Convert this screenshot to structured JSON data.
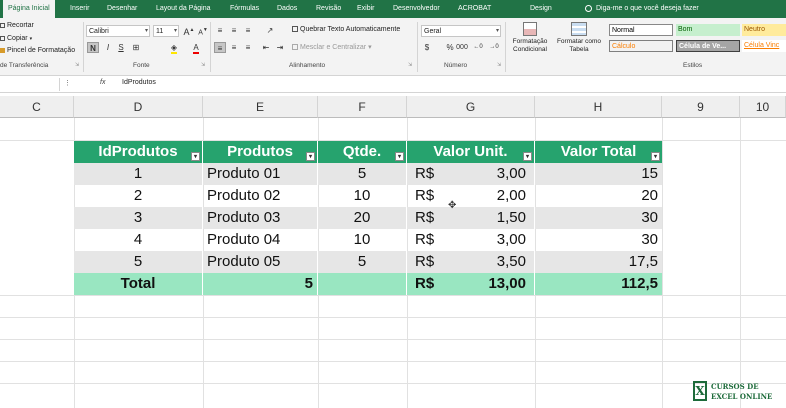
{
  "tabs": [
    "Página Inicial",
    "Inserir",
    "Desenhar",
    "Layout da Página",
    "Fórmulas",
    "Dados",
    "Revisão",
    "Exibir",
    "Desenvolvedor",
    "ACROBAT",
    "Design"
  ],
  "tell_me": "Diga-me o que você deseja fazer",
  "clipboard": {
    "cut": "Recortar",
    "copy": "Copiar",
    "painter": "Pincel de Formatação",
    "label": "de Transferência"
  },
  "font": {
    "name": "Calibri",
    "size": "11",
    "label": "Fonte"
  },
  "alignment": {
    "wrap": "Quebrar Texto Automaticamente",
    "merge": "Mesclar e Centralizar",
    "label": "Alinhamento"
  },
  "number": {
    "format": "Geral",
    "label": "Número"
  },
  "styles": {
    "cond_format": "Formatação Condicional",
    "as_table": "Formatar como Tabela",
    "normal": "Normal",
    "bom": "Bom",
    "neutro": "Neutro",
    "calculo": "Cálculo",
    "celula_ve": "Célula de Ve...",
    "celula_vinc": "Célula Vinc",
    "label": "Estilos"
  },
  "formula_bar": {
    "fx": "fx",
    "value": "IdProdutos"
  },
  "columns": [
    "C",
    "D",
    "E",
    "F",
    "G",
    "H",
    "9",
    "10"
  ],
  "table": {
    "headers": [
      "IdProdutos",
      "Produtos",
      "Qtde.",
      "Valor Unit.",
      "Valor Total"
    ],
    "rows": [
      {
        "id": "1",
        "produto": "Produto 01",
        "qtde": "5",
        "cur": "R$",
        "unit": "3,00",
        "total": "15"
      },
      {
        "id": "2",
        "produto": "Produto 02",
        "qtde": "10",
        "cur": "R$",
        "unit": "2,00",
        "total": "20"
      },
      {
        "id": "3",
        "produto": "Produto 03",
        "qtde": "20",
        "cur": "R$",
        "unit": "1,50",
        "total": "30"
      },
      {
        "id": "4",
        "produto": "Produto 04",
        "qtde": "10",
        "cur": "R$",
        "unit": "3,00",
        "total": "30"
      },
      {
        "id": "5",
        "produto": "Produto 05",
        "qtde": "5",
        "cur": "R$",
        "unit": "3,50",
        "total": "17,5"
      }
    ],
    "total": {
      "label": "Total",
      "produtos": "5",
      "cur": "R$",
      "unit": "13,00",
      "total": "112,5"
    }
  },
  "logo": {
    "line1": "CURSOS DE",
    "line2": "EXCEL ONLINE"
  },
  "colors": {
    "ribbon": "#217346",
    "header": "#26a36e",
    "total": "#99e6c1",
    "band": "#e6e6e6"
  }
}
